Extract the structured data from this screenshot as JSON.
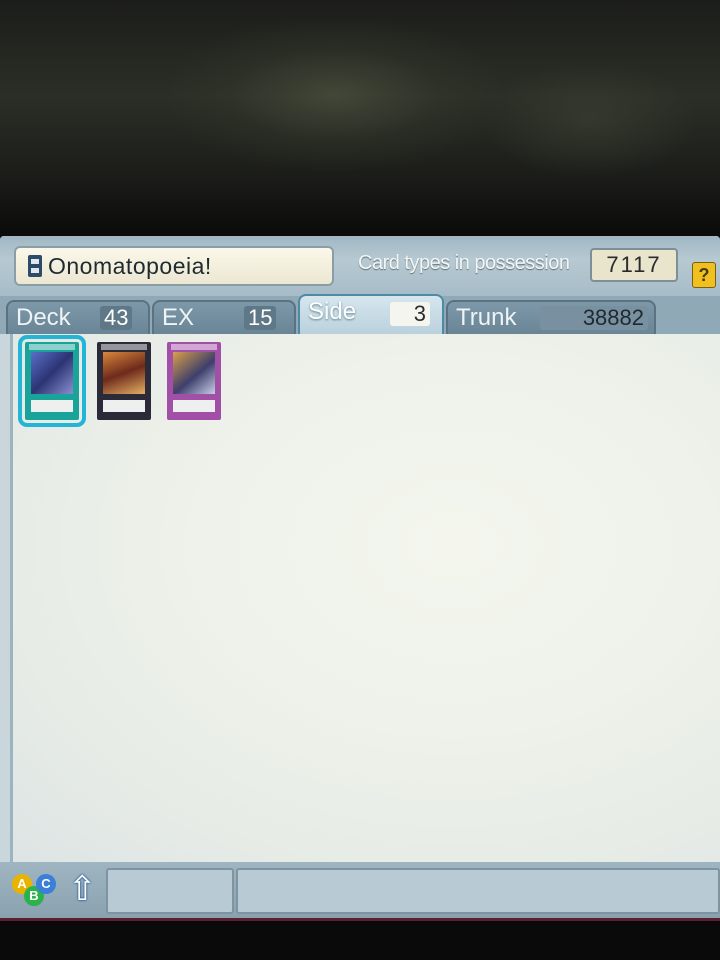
{
  "header": {
    "deck_name": "Onomatopoeia!",
    "possession_label": "Card types in possession",
    "possession_value": "7117",
    "help_label": "?"
  },
  "tabs": [
    {
      "label": "Deck",
      "count": "43",
      "active": false
    },
    {
      "label": "EX",
      "count": "15",
      "active": false
    },
    {
      "label": "Side",
      "count": "3",
      "active": true
    },
    {
      "label": "Trunk",
      "count": "38882",
      "active": false
    }
  ],
  "side_cards": [
    {
      "card_type": "spell",
      "frame_color": "#1aa39a",
      "selected": true
    },
    {
      "card_type": "monster",
      "frame_color": "#2a2a38",
      "selected": false
    },
    {
      "card_type": "trap",
      "frame_color": "#a24fa8",
      "selected": false
    }
  ],
  "bottom_bar": {
    "sort_abc_letters": [
      "A",
      "B",
      "C"
    ],
    "sort_arrow_icon": "up-arrow-icon",
    "colors": {
      "a": "#e8b400",
      "b": "#2bb24a",
      "c": "#3b7fd9"
    }
  },
  "colors": {
    "accent": "#22b5d6",
    "header_bg": "#a9bfcb",
    "card_area_bg": "#eef2ea"
  }
}
